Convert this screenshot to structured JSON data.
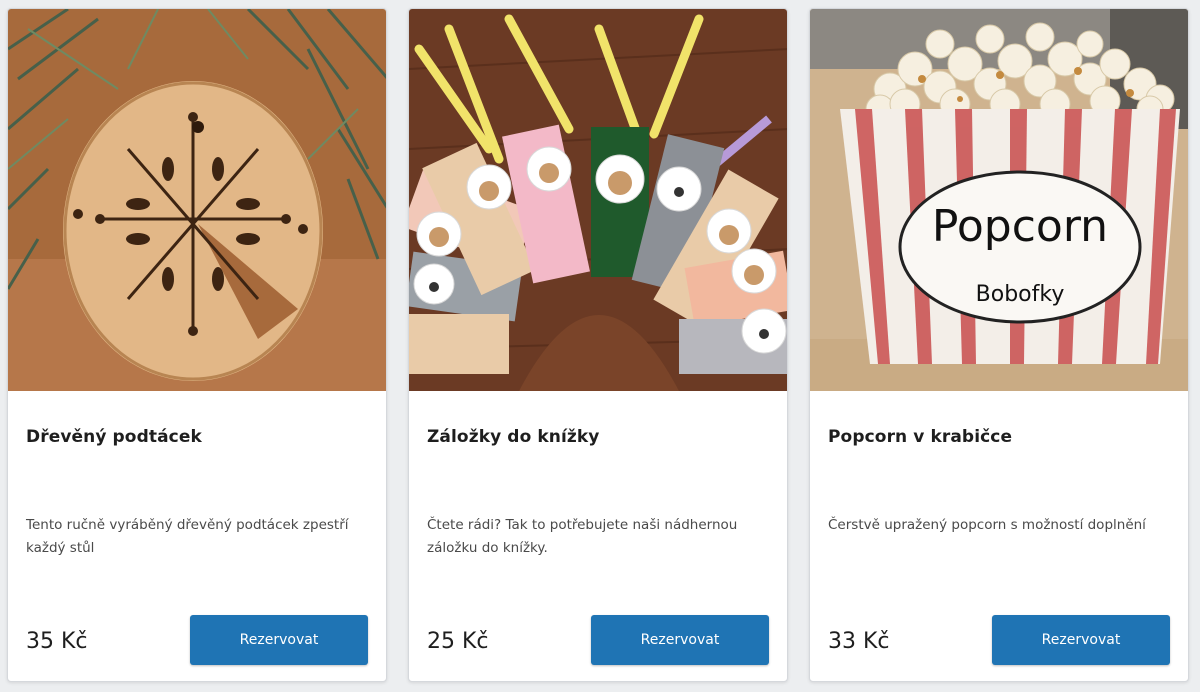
{
  "products": [
    {
      "title": "Dřevěný podtácek",
      "description": "Tento ručně vyráběný dřevěný podtácek zpestří každý stůl",
      "price": "35 Kč",
      "button_label": "Rezervovat",
      "image_icon": "wooden-coaster-photo"
    },
    {
      "title": "Záložky do knížky",
      "description": "Čtete rádi? Tak to potřebujete naši nádhernou záložku do knížky.",
      "price": "25 Kč",
      "button_label": "Rezervovat",
      "image_icon": "bookmarks-photo"
    },
    {
      "title": "Popcorn v krabičce",
      "description": "Čerstvě upražený popcorn s možností doplnění",
      "price": "33 Kč",
      "button_label": "Rezervovat",
      "image_icon": "popcorn-box-photo",
      "image_text_line1": "Popcorn",
      "image_text_line2": "Bobofky"
    }
  ],
  "colors": {
    "button": "#1f74b4",
    "title_text": "#1e1e1e",
    "description_text": "#4a4a4a"
  }
}
